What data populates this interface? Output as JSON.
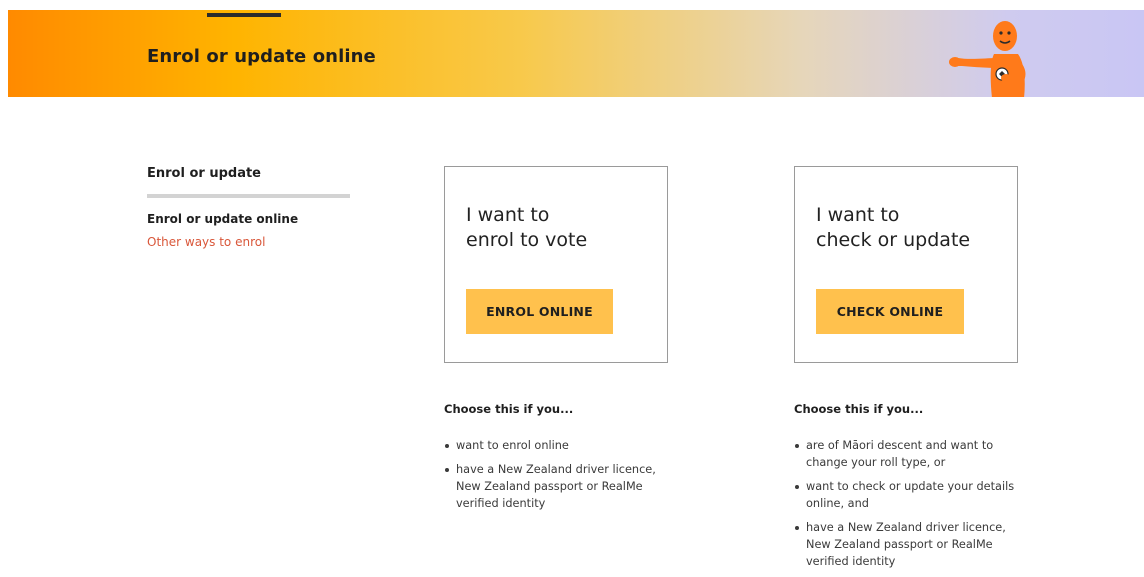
{
  "banner": {
    "title": "Enrol or update online",
    "mascot_icon": "orange-mascot-pointing-icon"
  },
  "side_nav": {
    "heading": "Enrol or update",
    "items": [
      {
        "label": "Enrol or update online",
        "current": true
      },
      {
        "label": "Other ways to enrol",
        "current": false
      }
    ]
  },
  "cards": [
    {
      "heading_line1": "I want to",
      "heading_line2": "enrol to vote",
      "button_label": "ENROL ONLINE"
    },
    {
      "heading_line1": "I want to",
      "heading_line2": "check or update",
      "button_label": "CHECK ONLINE"
    }
  ],
  "choose": [
    {
      "heading": "Choose this if you...",
      "items": [
        "want to enrol online",
        "have a New Zealand driver licence, New Zealand passport or RealMe verified identity"
      ]
    },
    {
      "heading": "Choose this if you...",
      "items": [
        "are of Māori descent and want to change your roll type, or",
        "want to check or update your details online, and",
        "have a New Zealand driver licence, New Zealand passport or RealMe verified identity"
      ]
    }
  ],
  "colors": {
    "accent_button": "#ffc14d",
    "link": "#d9573a",
    "banner_start": "#ff8a00",
    "banner_end": "#c9c6f4"
  }
}
